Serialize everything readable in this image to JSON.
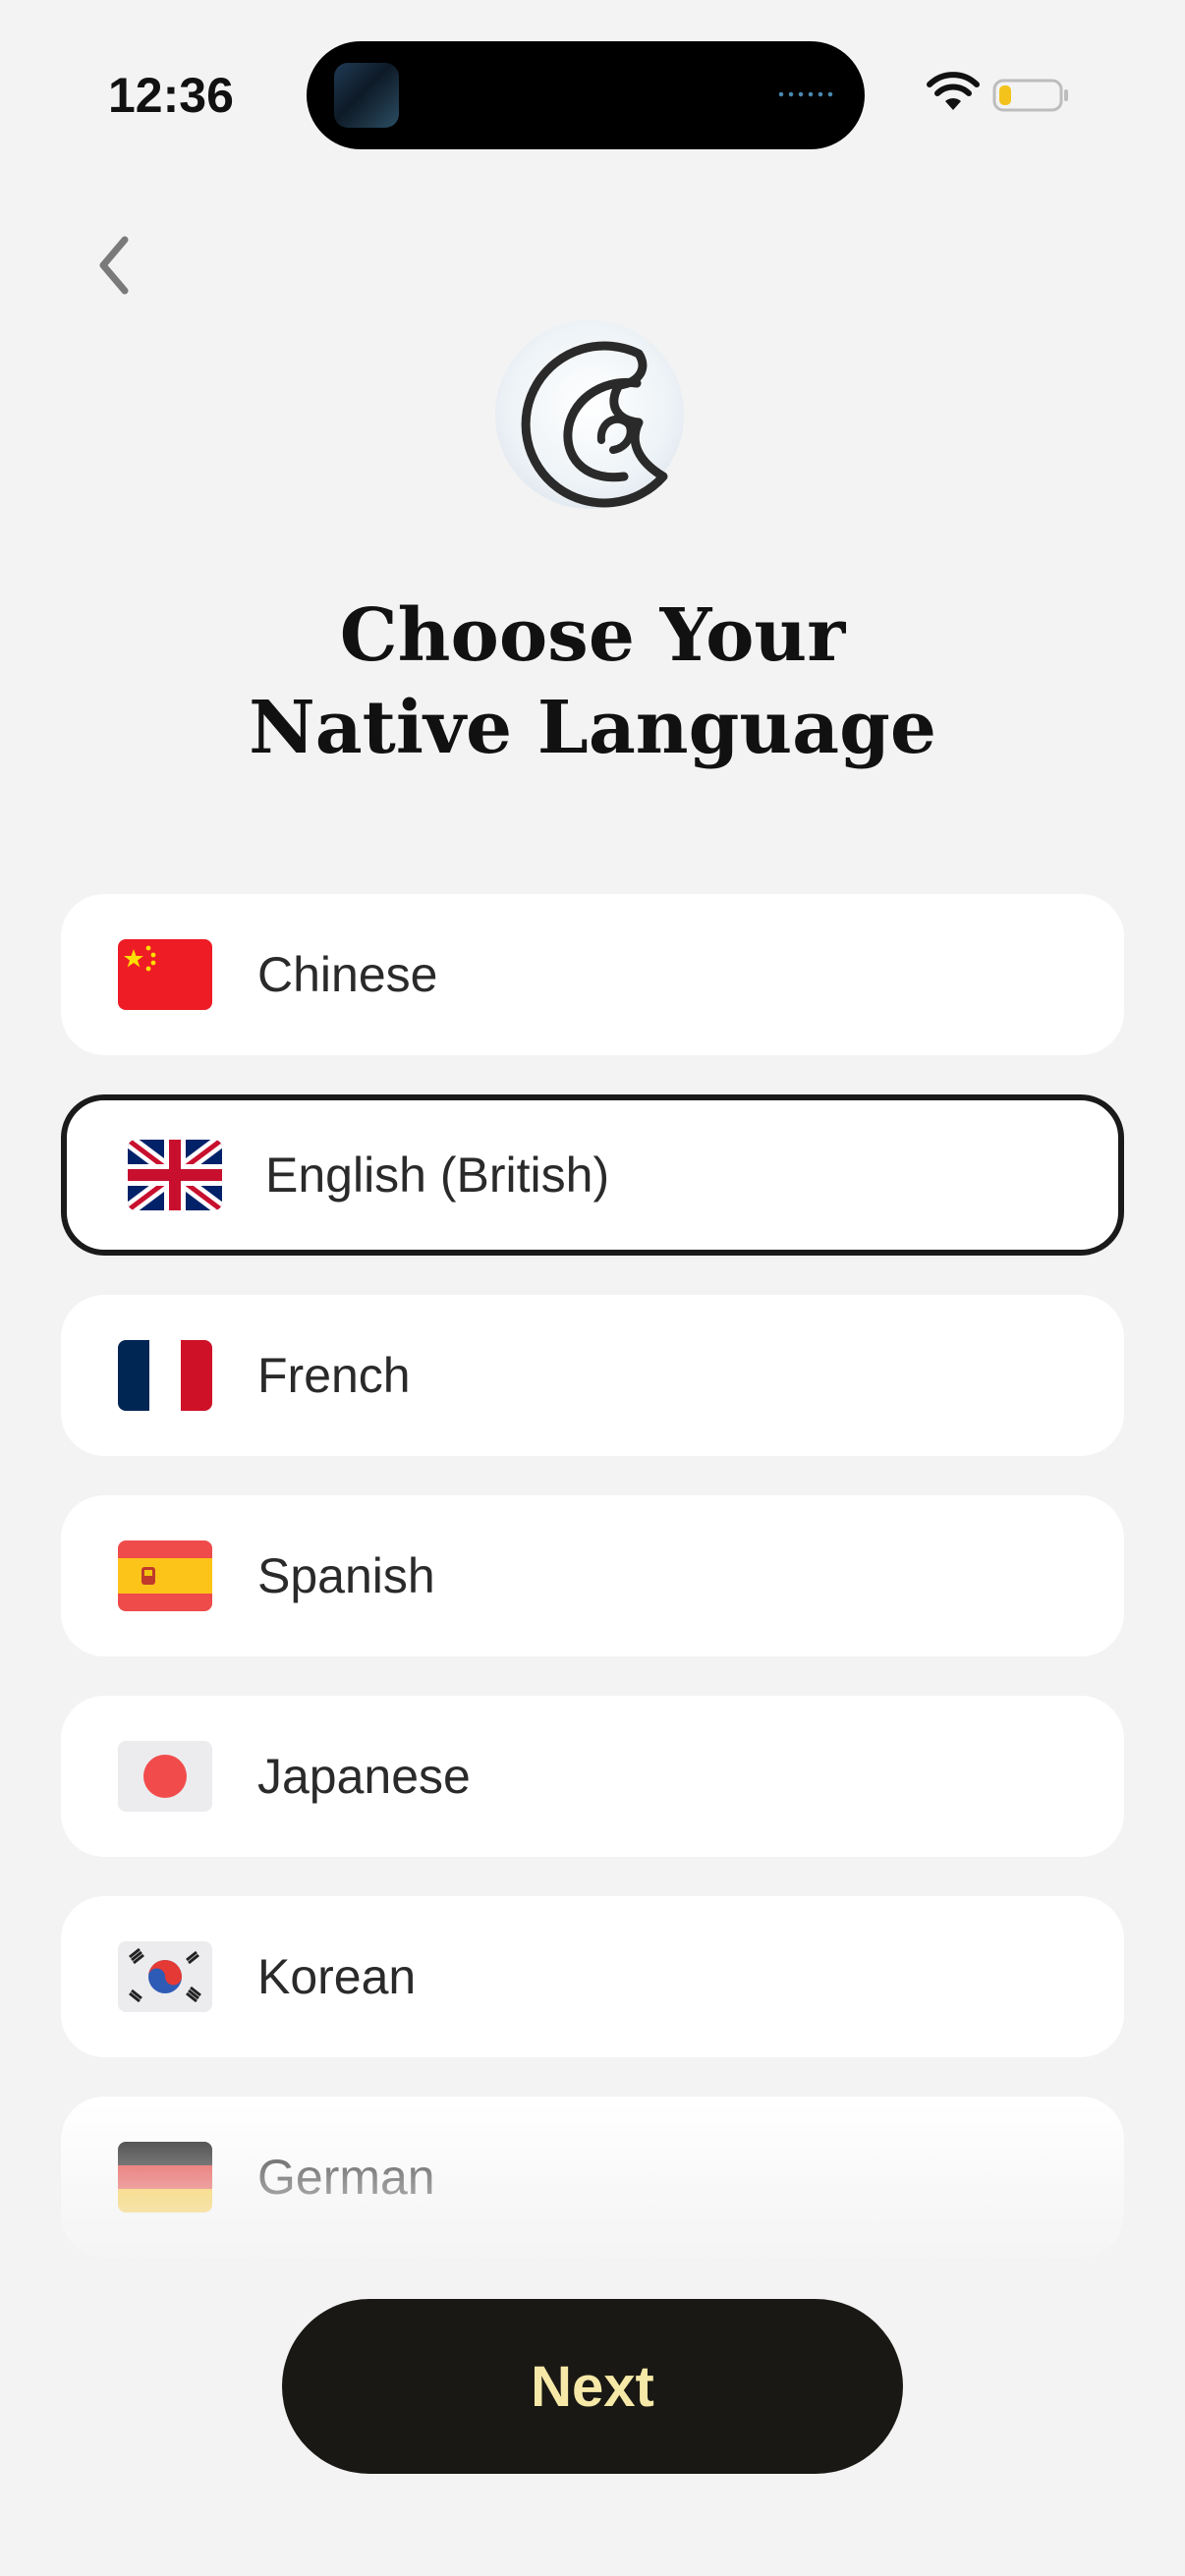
{
  "status_bar": {
    "time": "12:36",
    "battery_level": 0.2,
    "battery_color": "#f3c31b"
  },
  "header": {
    "title_line1": "Choose Your",
    "title_line2": "Native Language"
  },
  "languages": [
    {
      "label": "Chinese",
      "flag": "china-flag-icon",
      "selected": false
    },
    {
      "label": "English (British)",
      "flag": "uk-flag-icon",
      "selected": true
    },
    {
      "label": "French",
      "flag": "france-flag-icon",
      "selected": false
    },
    {
      "label": "Spanish",
      "flag": "spain-flag-icon",
      "selected": false
    },
    {
      "label": "Japanese",
      "flag": "japan-flag-icon",
      "selected": false
    },
    {
      "label": "Korean",
      "flag": "korea-flag-icon",
      "selected": false
    },
    {
      "label": "German",
      "flag": "germany-flag-icon",
      "selected": false
    }
  ],
  "footer": {
    "next_label": "Next"
  },
  "colors": {
    "background": "#f3f3f3",
    "button_bg": "#1a1814",
    "button_text": "#f6e9a8",
    "selected_border": "#1a1a1a"
  }
}
